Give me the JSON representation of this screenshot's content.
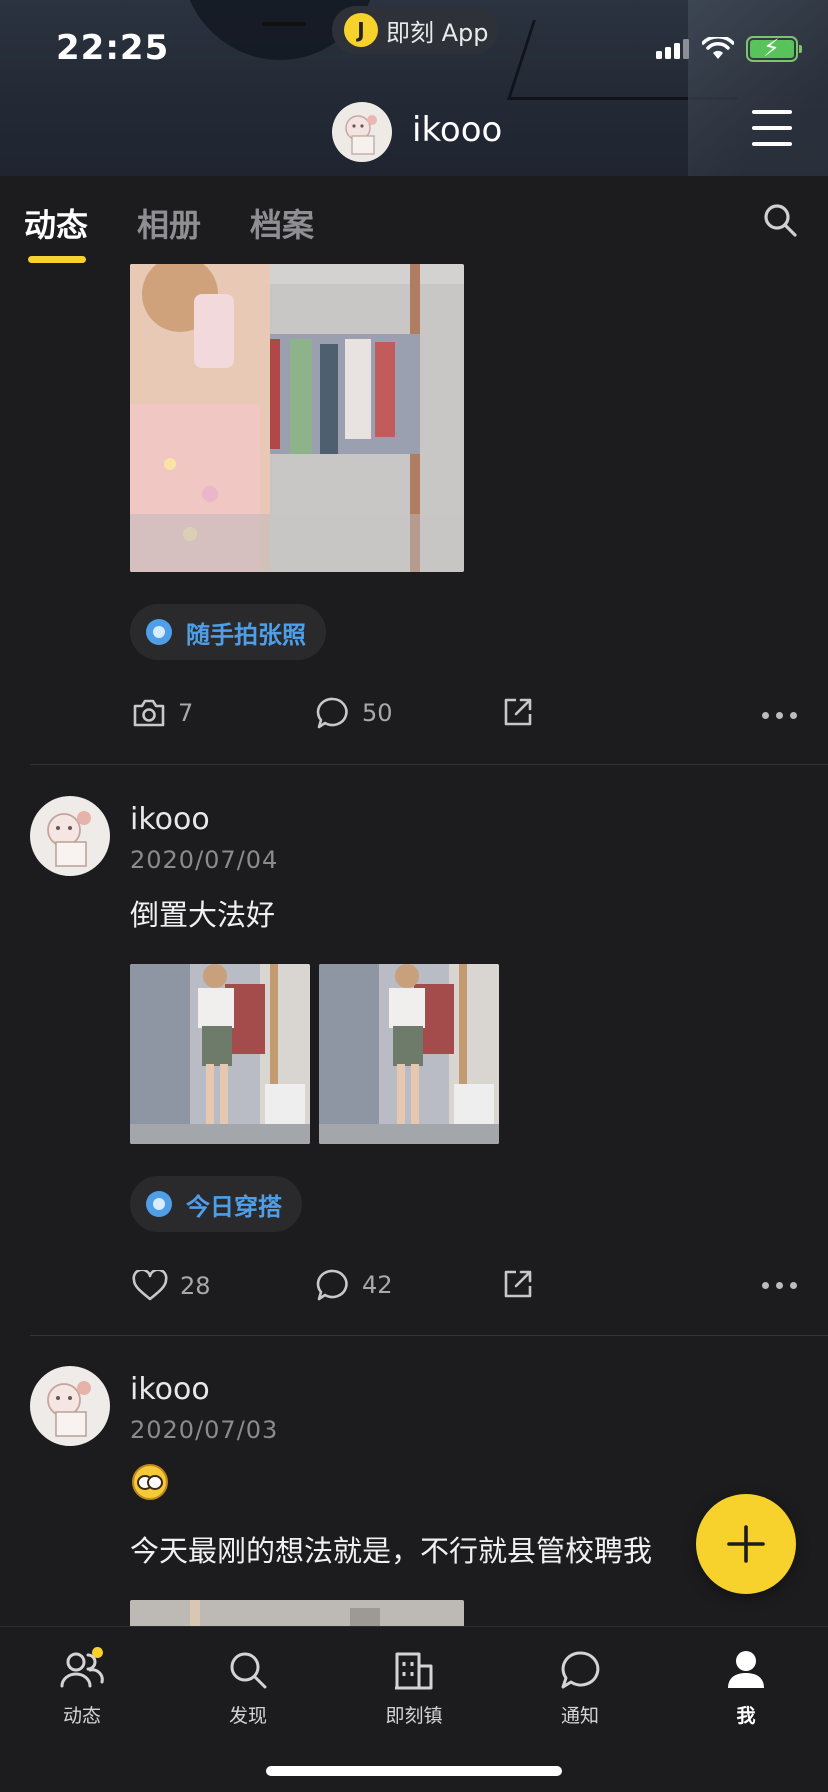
{
  "status_bar": {
    "time": "22:25",
    "island_app": "即刻 App",
    "island_icon_letter": "J"
  },
  "profile": {
    "name": "ikooo"
  },
  "tabs": [
    {
      "label": "动态",
      "active": true
    },
    {
      "label": "相册",
      "active": false
    },
    {
      "label": "档案",
      "active": false
    }
  ],
  "posts": [
    {
      "tag": "随手拍张照",
      "actions": {
        "first_icon": "camera-icon",
        "first_count": "7",
        "comments": "50"
      }
    },
    {
      "author": "ikooo",
      "date": "2020/07/04",
      "text": "倒置大法好",
      "tag": "今日穿搭",
      "actions": {
        "first_icon": "heart-icon",
        "first_count": "28",
        "comments": "42"
      }
    },
    {
      "author": "ikooo",
      "date": "2020/07/03",
      "emoji": "nerd-face-emoji",
      "text": "今天最刚的想法就是，不行就县管校聘我"
    }
  ],
  "bottom_nav": [
    {
      "label": "动态",
      "icon": "people-icon",
      "badge": true
    },
    {
      "label": "发现",
      "icon": "search-icon"
    },
    {
      "label": "即刻镇",
      "icon": "building-icon"
    },
    {
      "label": "通知",
      "icon": "chat-bubble-icon"
    },
    {
      "label": "我",
      "icon": "person-icon",
      "active": true
    }
  ],
  "colors": {
    "accent": "#f7d22c",
    "tag_blue": "#4f9fe8",
    "background": "#1c1c1e"
  }
}
